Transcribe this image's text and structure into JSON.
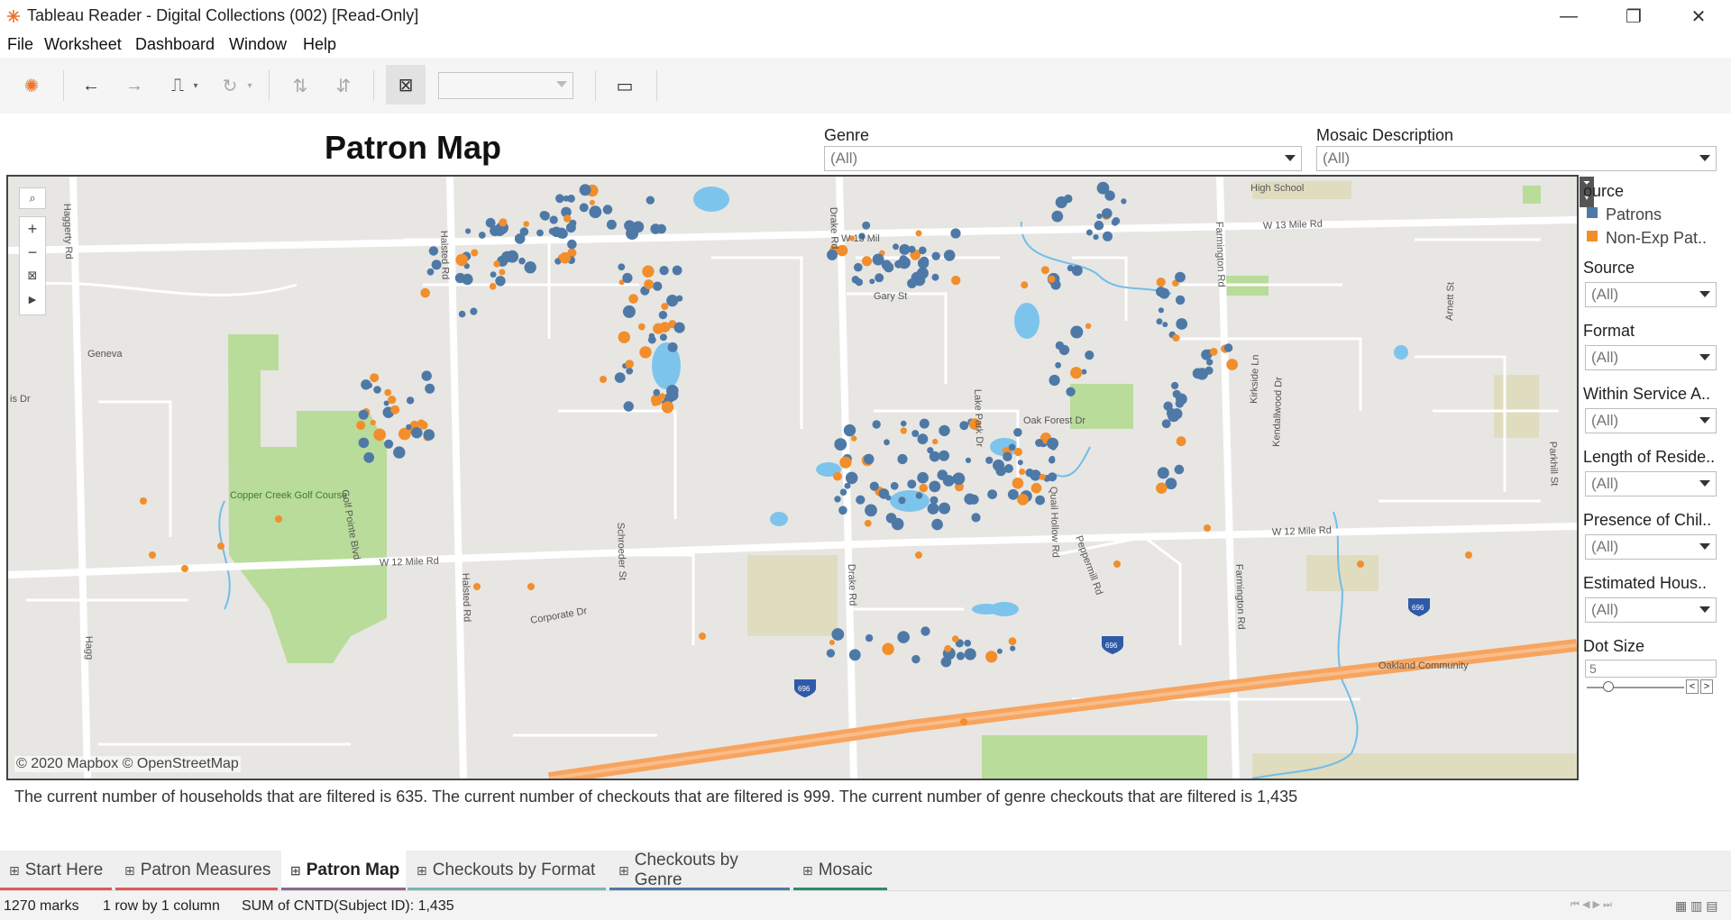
{
  "window": {
    "title": "Tableau Reader - Digital Collections (002) [Read-Only]"
  },
  "menu": [
    "File",
    "Worksheet",
    "Dashboard",
    "Window",
    "Help"
  ],
  "dashboard": {
    "title": "Patron Map"
  },
  "filters": {
    "genre": {
      "label": "Genre",
      "value": "(All)"
    },
    "mosaic": {
      "label": "Mosaic Description",
      "value": "(All)"
    }
  },
  "legend": {
    "title": "ource",
    "items": [
      {
        "label": "Patrons",
        "color": "#4e79a7"
      },
      {
        "label": "Non-Exp Pat..",
        "color": "#f28e2b"
      }
    ]
  },
  "side_filters": [
    {
      "label": "Source",
      "value": "(All)"
    },
    {
      "label": "Format",
      "value": "(All)"
    },
    {
      "label": "Within Service A..",
      "value": "(All)"
    },
    {
      "label": "Length of Reside..",
      "value": "(All)"
    },
    {
      "label": "Presence of Chil..",
      "value": "(All)"
    },
    {
      "label": "Estimated Hous..",
      "value": "(All)"
    }
  ],
  "dot_size": {
    "label": "Dot Size",
    "value": "5"
  },
  "map": {
    "attribution": "© 2020 Mapbox © OpenStreetMap",
    "labels": [
      "High School",
      "W 13 Mile Rd",
      "W 13 Mil",
      "Haggerty Rd",
      "Halsted Rd",
      "Drake Rd",
      "Farmington Rd",
      "Gary St",
      "Geneva",
      "is Dr",
      "Lake Park Dr",
      "Oak Forest Dr",
      "Kirkside Ln",
      "Kendallwood Dr",
      "Arnett St",
      "Copper Creek Golf Course",
      "Golf Pointe Blvd",
      "Schroeder St",
      "Quail Hollow Rd",
      "Peppermill Rd",
      "W 12 Mile Rd",
      "Parkhill St",
      "Corporate Dr",
      "Hagg",
      "696",
      "Oakland Community"
    ]
  },
  "summary": "The current number of households that are filtered is 635. The current number of checkouts that are filtered is 999. The current number of genre checkouts that are filtered is 1,435",
  "tabs": [
    {
      "label": "Start Here",
      "color": "#e15759"
    },
    {
      "label": "Patron Measures",
      "color": "#e15759"
    },
    {
      "label": "Patron Map",
      "color": "#8a6a8e"
    },
    {
      "label": "Checkouts by Format",
      "color": "#76b7b2"
    },
    {
      "label": "Checkouts by Genre",
      "color": "#4e79a7"
    },
    {
      "label": "Mosaic",
      "color": "#2e8b6e"
    }
  ],
  "status": {
    "marks": "1270 marks",
    "shape": "1 row by 1 column",
    "sum": "SUM of CNTD(Subject ID): 1,435"
  }
}
